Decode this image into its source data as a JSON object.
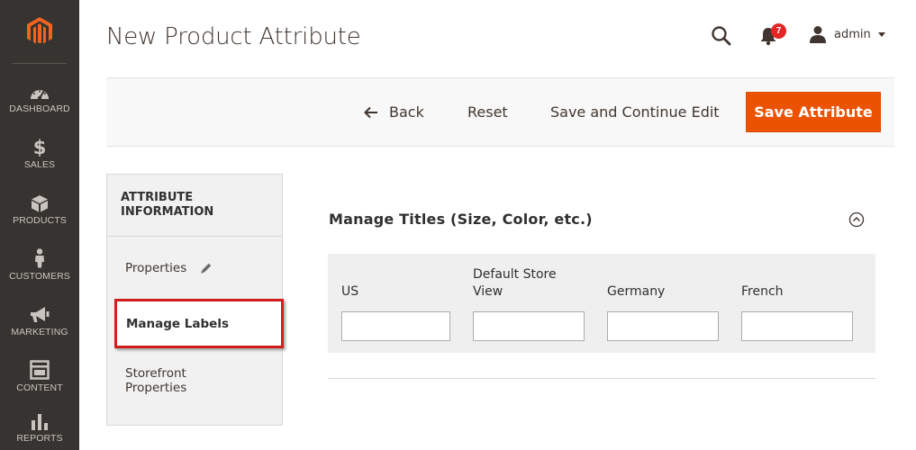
{
  "nav": {
    "items": [
      {
        "label": "DASHBOARD",
        "icon": "dashboard-icon"
      },
      {
        "label": "SALES",
        "icon": "dollar-icon"
      },
      {
        "label": "PRODUCTS",
        "icon": "cube-icon"
      },
      {
        "label": "CUSTOMERS",
        "icon": "person-icon"
      },
      {
        "label": "MARKETING",
        "icon": "megaphone-icon"
      },
      {
        "label": "CONTENT",
        "icon": "layout-icon"
      },
      {
        "label": "REPORTS",
        "icon": "bar-chart-icon"
      }
    ],
    "background": "#373330"
  },
  "header": {
    "title": "New Product Attribute",
    "notification_count": "7",
    "user": "admin"
  },
  "toolbar": {
    "back_label": "Back",
    "reset_label": "Reset",
    "save_continue_label": "Save and Continue Edit",
    "save_label": "Save Attribute",
    "accent": "#eb5202"
  },
  "tabs": {
    "heading": "ATTRIBUTE INFORMATION",
    "items": [
      {
        "label": "Properties"
      },
      {
        "label": "Manage Labels"
      },
      {
        "label": "Storefront Properties"
      }
    ],
    "highlight": "#d21e1e"
  },
  "section": {
    "title": "Manage Titles (Size, Color, etc.)",
    "columns": [
      {
        "label": "US",
        "value": ""
      },
      {
        "label": "Default Store View",
        "value": ""
      },
      {
        "label": "Germany",
        "value": ""
      },
      {
        "label": "French",
        "value": ""
      }
    ]
  }
}
